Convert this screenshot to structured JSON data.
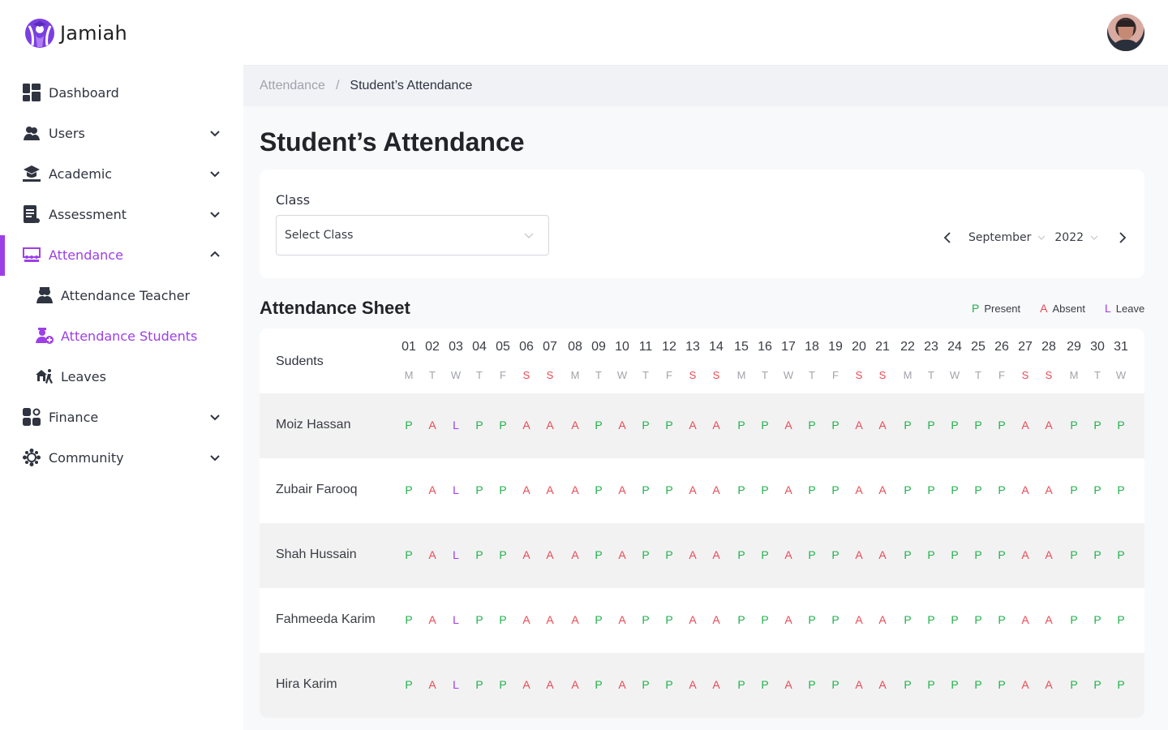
{
  "app": {
    "name": "Jamiah"
  },
  "user": {
    "avatar_icon": "user-avatar"
  },
  "colors": {
    "accent": "#9d3fe7",
    "present": "#22b14c",
    "absent": "#e84a55",
    "leave": "#9d3fe7",
    "weekend": "#e84a55"
  },
  "sidebar": {
    "items": [
      {
        "label": "Dashboard",
        "icon": "dashboard-icon",
        "has_chevron": false
      },
      {
        "label": "Users",
        "icon": "users-icon",
        "has_chevron": true
      },
      {
        "label": "Academic",
        "icon": "graduation-cap-icon",
        "has_chevron": true
      },
      {
        "label": "Assessment",
        "icon": "document-icon",
        "has_chevron": true
      },
      {
        "label": "Attendance",
        "icon": "classroom-icon",
        "has_chevron": true,
        "expanded": true,
        "active": true
      },
      {
        "label": "Finance",
        "icon": "finance-icon",
        "has_chevron": true
      },
      {
        "label": "Community",
        "icon": "community-icon",
        "has_chevron": true
      }
    ],
    "sub_items": [
      {
        "label": "Attendance Teacher",
        "icon": "teacher-icon"
      },
      {
        "label": "Attendance Students",
        "icon": "student-add-icon",
        "active": true
      },
      {
        "label": "Leaves",
        "icon": "leave-icon"
      }
    ]
  },
  "breadcrumb": {
    "parent": "Attendance",
    "separator": "/",
    "current": "Student’s Attendance"
  },
  "page": {
    "title": "Student’s Attendance"
  },
  "filters": {
    "class_label": "Class",
    "class_placeholder": "Select Class",
    "month": "September",
    "year": "2022"
  },
  "sheet": {
    "title": "Attendance Sheet",
    "students_header": "Sudents",
    "legend": [
      {
        "code": "P",
        "label": "Present"
      },
      {
        "code": "A",
        "label": "Absent"
      },
      {
        "code": "L",
        "label": "Leave"
      }
    ],
    "days": [
      {
        "num": "01",
        "wd": "M"
      },
      {
        "num": "02",
        "wd": "T"
      },
      {
        "num": "03",
        "wd": "W"
      },
      {
        "num": "04",
        "wd": "T"
      },
      {
        "num": "05",
        "wd": "F"
      },
      {
        "num": "06",
        "wd": "S",
        "weekend": true
      },
      {
        "num": "07",
        "wd": "S",
        "weekend": true
      },
      {
        "num": "08",
        "wd": "M"
      },
      {
        "num": "09",
        "wd": "T"
      },
      {
        "num": "10",
        "wd": "W"
      },
      {
        "num": "11",
        "wd": "T"
      },
      {
        "num": "12",
        "wd": "F"
      },
      {
        "num": "13",
        "wd": "S",
        "weekend": true
      },
      {
        "num": "14",
        "wd": "S",
        "weekend": true
      },
      {
        "num": "15",
        "wd": "M"
      },
      {
        "num": "16",
        "wd": "T"
      },
      {
        "num": "17",
        "wd": "W"
      },
      {
        "num": "18",
        "wd": "T"
      },
      {
        "num": "19",
        "wd": "F"
      },
      {
        "num": "20",
        "wd": "S",
        "weekend": true
      },
      {
        "num": "21",
        "wd": "S",
        "weekend": true
      },
      {
        "num": "22",
        "wd": "M"
      },
      {
        "num": "23",
        "wd": "T"
      },
      {
        "num": "24",
        "wd": "W"
      },
      {
        "num": "25",
        "wd": "T"
      },
      {
        "num": "26",
        "wd": "F"
      },
      {
        "num": "27",
        "wd": "S",
        "weekend": true
      },
      {
        "num": "28",
        "wd": "S",
        "weekend": true
      },
      {
        "num": "29",
        "wd": "M"
      },
      {
        "num": "30",
        "wd": "T"
      },
      {
        "num": "31",
        "wd": "W"
      }
    ],
    "students": [
      {
        "name": "Moiz Hassan",
        "attendance": [
          "P",
          "A",
          "L",
          "P",
          "P",
          "A",
          "A",
          "A",
          "P",
          "A",
          "P",
          "P",
          "A",
          "A",
          "P",
          "P",
          "A",
          "P",
          "P",
          "A",
          "A",
          "P",
          "P",
          "P",
          "P",
          "P",
          "A",
          "A",
          "P",
          "P",
          "P"
        ]
      },
      {
        "name": "Zubair Farooq",
        "attendance": [
          "P",
          "A",
          "L",
          "P",
          "P",
          "A",
          "A",
          "A",
          "P",
          "A",
          "P",
          "P",
          "A",
          "A",
          "P",
          "P",
          "A",
          "P",
          "P",
          "A",
          "A",
          "P",
          "P",
          "P",
          "P",
          "P",
          "A",
          "A",
          "P",
          "P",
          "P"
        ]
      },
      {
        "name": "Shah Hussain",
        "attendance": [
          "P",
          "A",
          "L",
          "P",
          "P",
          "A",
          "A",
          "A",
          "P",
          "A",
          "P",
          "P",
          "A",
          "A",
          "P",
          "P",
          "A",
          "P",
          "P",
          "A",
          "A",
          "P",
          "P",
          "P",
          "P",
          "P",
          "A",
          "A",
          "P",
          "P",
          "P"
        ]
      },
      {
        "name": "Fahmeeda Karim",
        "attendance": [
          "P",
          "A",
          "L",
          "P",
          "P",
          "A",
          "A",
          "A",
          "P",
          "A",
          "P",
          "P",
          "A",
          "A",
          "P",
          "P",
          "A",
          "P",
          "P",
          "A",
          "A",
          "P",
          "P",
          "P",
          "P",
          "P",
          "A",
          "A",
          "P",
          "P",
          "P"
        ]
      },
      {
        "name": "Hira Karim",
        "attendance": [
          "P",
          "A",
          "L",
          "P",
          "P",
          "A",
          "A",
          "A",
          "P",
          "A",
          "P",
          "P",
          "A",
          "A",
          "P",
          "P",
          "A",
          "P",
          "P",
          "A",
          "A",
          "P",
          "P",
          "P",
          "P",
          "P",
          "A",
          "A",
          "P",
          "P",
          "P"
        ]
      }
    ]
  }
}
